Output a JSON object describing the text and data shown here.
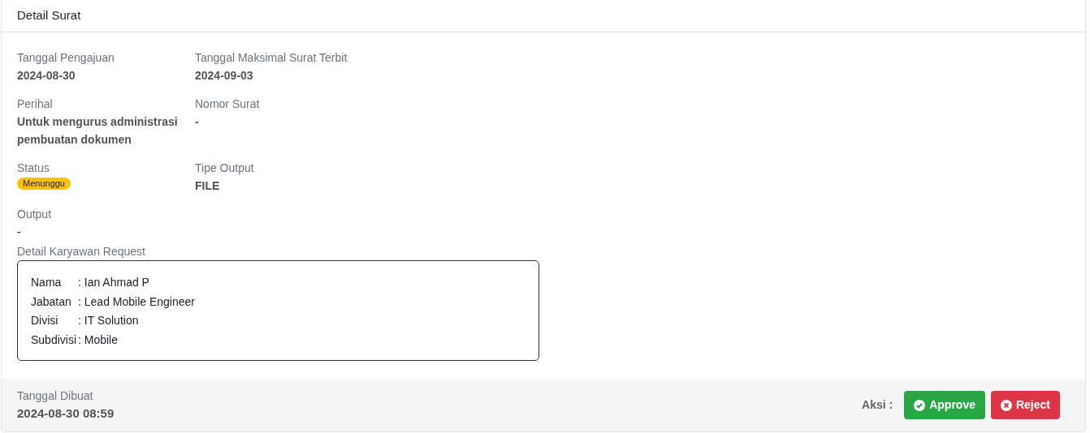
{
  "card": {
    "title": "Detail Surat"
  },
  "field_rows": [
    [
      {
        "label": "Tanggal Pengajuan",
        "value": "2024-08-30",
        "kind": "text"
      },
      {
        "label": "Tanggal Maksimal Surat Terbit",
        "value": "2024-09-03",
        "kind": "text"
      }
    ],
    [
      {
        "label": "Perihal",
        "value": "Untuk mengurus administrasi pembuatan dokumen",
        "kind": "text"
      },
      {
        "label": "Nomor Surat",
        "value": "-",
        "kind": "text"
      }
    ],
    [
      {
        "label": "Status",
        "value": "Menunggu",
        "kind": "badge",
        "color": "#ffc107"
      },
      {
        "label": "Tipe Output",
        "value": "FILE",
        "kind": "text"
      }
    ],
    [
      {
        "label": "Output",
        "value": "-",
        "kind": "plain"
      }
    ]
  ],
  "employee": {
    "label": "Detail Karyawan Request",
    "rows": [
      {
        "label": "Nama",
        "value": ": Ian Ahmad P"
      },
      {
        "label": "Jabatan",
        "value": ": Lead Mobile Engineer"
      },
      {
        "label": "Divisi",
        "value": ": IT Solution"
      },
      {
        "label": "Subdivisi",
        "value": ": Mobile"
      }
    ]
  },
  "footer": {
    "label": "Tanggal Dibuat",
    "value": "2024-08-30 08:59",
    "actions_label": "Aksi :",
    "buttons": [
      {
        "label": "Approve",
        "kind": "approve"
      },
      {
        "label": "Reject",
        "kind": "reject"
      }
    ]
  }
}
